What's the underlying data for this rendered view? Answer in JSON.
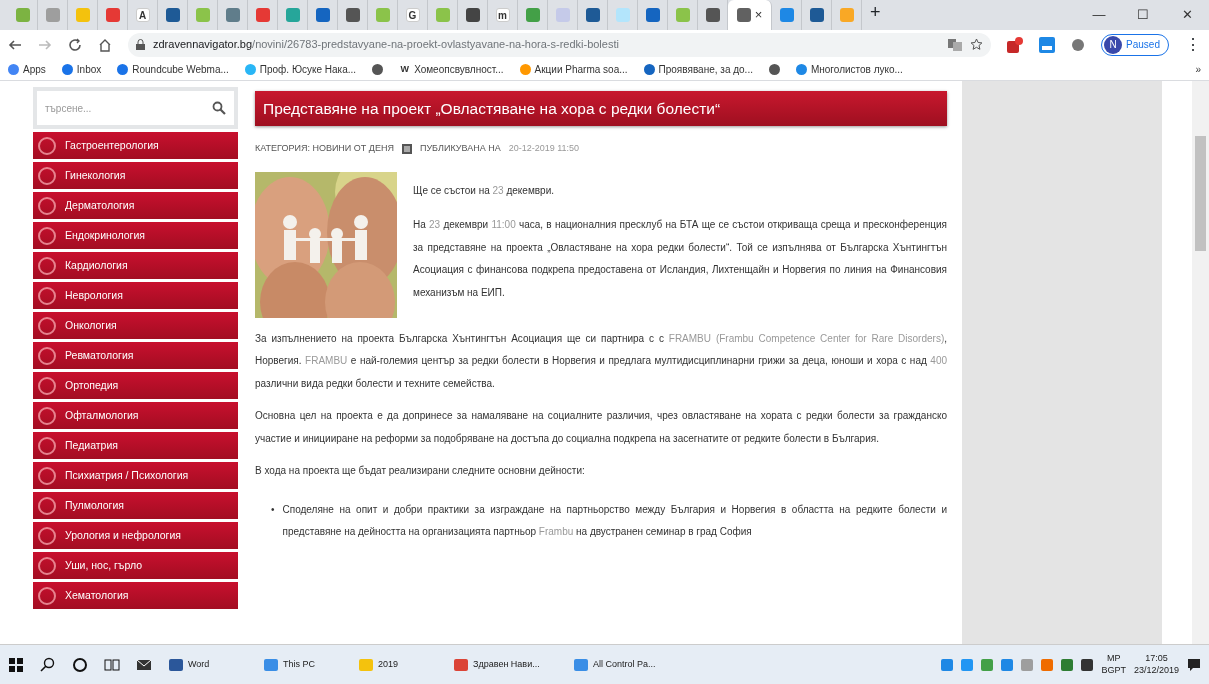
{
  "browser_tabs": [
    {
      "color": "#7cb342",
      "selected": false
    },
    {
      "color": "#9e9e9e",
      "selected": false
    },
    {
      "color": "#f4c20d",
      "selected": false
    },
    {
      "color": "#e53935",
      "selected": false
    },
    {
      "color": "#ffffff",
      "glyph": "A",
      "selected": false
    },
    {
      "color": "#1e5a96",
      "selected": false
    },
    {
      "color": "#8bc34a",
      "selected": false
    },
    {
      "color": "#607d8b",
      "selected": false
    },
    {
      "color": "#e53935",
      "selected": false
    },
    {
      "color": "#26a69a",
      "selected": false
    },
    {
      "color": "#1565c0",
      "selected": false
    },
    {
      "color": "#555555",
      "selected": false
    },
    {
      "color": "#8bc34a",
      "selected": false
    },
    {
      "color": "#ffffff",
      "glyph": "G",
      "selected": false
    },
    {
      "color": "#8bc34a",
      "selected": false
    },
    {
      "color": "#444444",
      "selected": false
    },
    {
      "color": "#ffffff",
      "glyph": "m",
      "selected": false
    },
    {
      "color": "#43a047",
      "selected": false
    },
    {
      "color": "#c5cae9",
      "selected": false
    },
    {
      "color": "#1e5a96",
      "selected": false
    },
    {
      "color": "#b3e5fc",
      "selected": false
    },
    {
      "color": "#1565c0",
      "selected": false
    },
    {
      "color": "#8bc34a",
      "selected": false
    },
    {
      "color": "#555555",
      "selected": false
    },
    {
      "color": "#616161",
      "selected": true,
      "close": "×"
    },
    {
      "color": "#1e88e5",
      "selected": false
    },
    {
      "color": "#1e5a96",
      "selected": false
    },
    {
      "color": "#f9a825",
      "selected": false
    }
  ],
  "new_tab": "+",
  "window_controls": [
    "—",
    "☐",
    "✕"
  ],
  "address_bar": {
    "domain": "zdravennavigator.bg",
    "path": "/novini/26783-predstavyane-na-proekt-ovlastyavane-na-hora-s-redki-bolesti"
  },
  "profile": {
    "initial": "N",
    "label": "Paused"
  },
  "menu_glyph": "⋮",
  "bookmarks": [
    {
      "label": "Apps",
      "color": "#4285f4"
    },
    {
      "label": "Inbox",
      "color": "#1a73e8"
    },
    {
      "label": "Roundcube Webma...",
      "color": "#1a73e8"
    },
    {
      "label": "Проф. Юсуке Нака...",
      "color": "#29b6f6"
    },
    {
      "color": "#555555"
    },
    {
      "label": "Хомеопсвувлност...",
      "color": "#333333",
      "glyph": "W"
    },
    {
      "label": "Акции Pharma soa...",
      "color": "#ff9800"
    },
    {
      "label": "Проявяване, за до...",
      "color": "#1565c0"
    },
    {
      "color": "#555555"
    },
    {
      "label": "Многолистов луко...",
      "color": "#1e88e5"
    }
  ],
  "bookmarks_more": "»",
  "sidebar": {
    "search_placeholder": "търсене...",
    "items": [
      "Гастроентерология",
      "Гинекология",
      "Дерматология",
      "Ендокринология",
      "Кардиология",
      "Неврология",
      "Онкология",
      "Ревматология",
      "Ортопедия",
      "Офталмология",
      "Педиатрия",
      "Психиатрия / Психология",
      "Пулмология",
      "Урология и нефрология",
      "Уши, нос, гърло",
      "Хематология"
    ]
  },
  "article": {
    "title": "Представяне на проект „Овластяване на хора с редки болести“",
    "category": "КАТЕГОРИЯ: НОВИНИ ОТ ДЕНЯ",
    "published_label": "ПУБЛИКУВАНА НА",
    "published_date": "20-12-2019 11:50",
    "intro": [
      [
        {
          "text": "Ще се състои на ",
          "light": false
        },
        {
          "text": "23",
          "light": true
        },
        {
          "text": " декември.",
          "light": false
        }
      ],
      [
        {
          "text": "На ",
          "light": false
        },
        {
          "text": "23",
          "light": true
        },
        {
          "text": " декември ",
          "light": false
        },
        {
          "text": "11:00",
          "light": true
        },
        {
          "text": " часа, в националния пресклуб на БТА ще се състои откриваща среща и пресконференция за представяне на проекта „Овластяване на хора редки болести“. Той се изпълнява от Българска Хънтингтън Асоциация с финансова подкрепа предоставена от Исландия, Лихтенщайн и Норвегия по линия на Финансовия механизъм на ЕИП.",
          "light": false
        }
      ]
    ],
    "paragraphs": [
      [
        {
          "text": "За изпълнението на проекта Българска Хънтингтън Асоциация ще си партнира с с ",
          "light": false
        },
        {
          "text": "FRAMBU (Frambu Competence Center for Rare Disorders)",
          "light": true
        },
        {
          "text": ", Норвегия. ",
          "light": false
        },
        {
          "text": "FRAMBU",
          "light": true
        },
        {
          "text": " е най-големия център за редки болести в Норвегия и предлага мултидисциплинарни грижи за деца, юноши и хора с над ",
          "light": false
        },
        {
          "text": "400",
          "light": true
        },
        {
          "text": " различни вида редки болести и техните семейства.",
          "light": false
        }
      ],
      [
        {
          "text": "Основна цел на проекта е да допринесе за намаляване на социалните различия, чрез овластяване на хората с редки болести за гражданско участие и иницииране на реформи за подобряване на достъпа до социална подкрепа на засегнатите от редките болести в България.",
          "light": false
        }
      ],
      [
        {
          "text": "В хода на проекта ще бъдат реализирани следните основни дейности:",
          "light": false
        }
      ]
    ],
    "bullets": [
      {
        "marker": "•",
        "segments": [
          {
            "text": "Споделяне на опит и добри практики за изграждане на партньорство между България и Норвегия в областта на редките болести и представяне на дейността на организацията партньор ",
            "light": false
          },
          {
            "text": "Frambu",
            "light": true
          },
          {
            "text": " на двустранен семинар в град София",
            "light": false
          }
        ]
      }
    ]
  },
  "taskbar": {
    "apps": [
      {
        "label": "Word",
        "color": "#2b579a"
      },
      {
        "label": "This PC",
        "color": "#3a8ee6"
      },
      {
        "label": "2019",
        "color": "#f4c20d"
      },
      {
        "label": "Здравен Нави...",
        "color": "#db4437"
      },
      {
        "label": "All Control Pa...",
        "color": "#3a8ee6"
      }
    ],
    "tray_icons": [
      {
        "color": "#1e88e5"
      },
      {
        "color": "#2196f3"
      },
      {
        "color": "#43a047"
      },
      {
        "color": "#1e88e5"
      },
      {
        "color": "#9e9e9e"
      },
      {
        "color": "#ef6c00"
      },
      {
        "color": "#2e7d32"
      },
      {
        "color": "#333333"
      }
    ],
    "language": [
      "МР",
      "BGPT"
    ],
    "time": "17:05",
    "date": "23/12/2019"
  }
}
